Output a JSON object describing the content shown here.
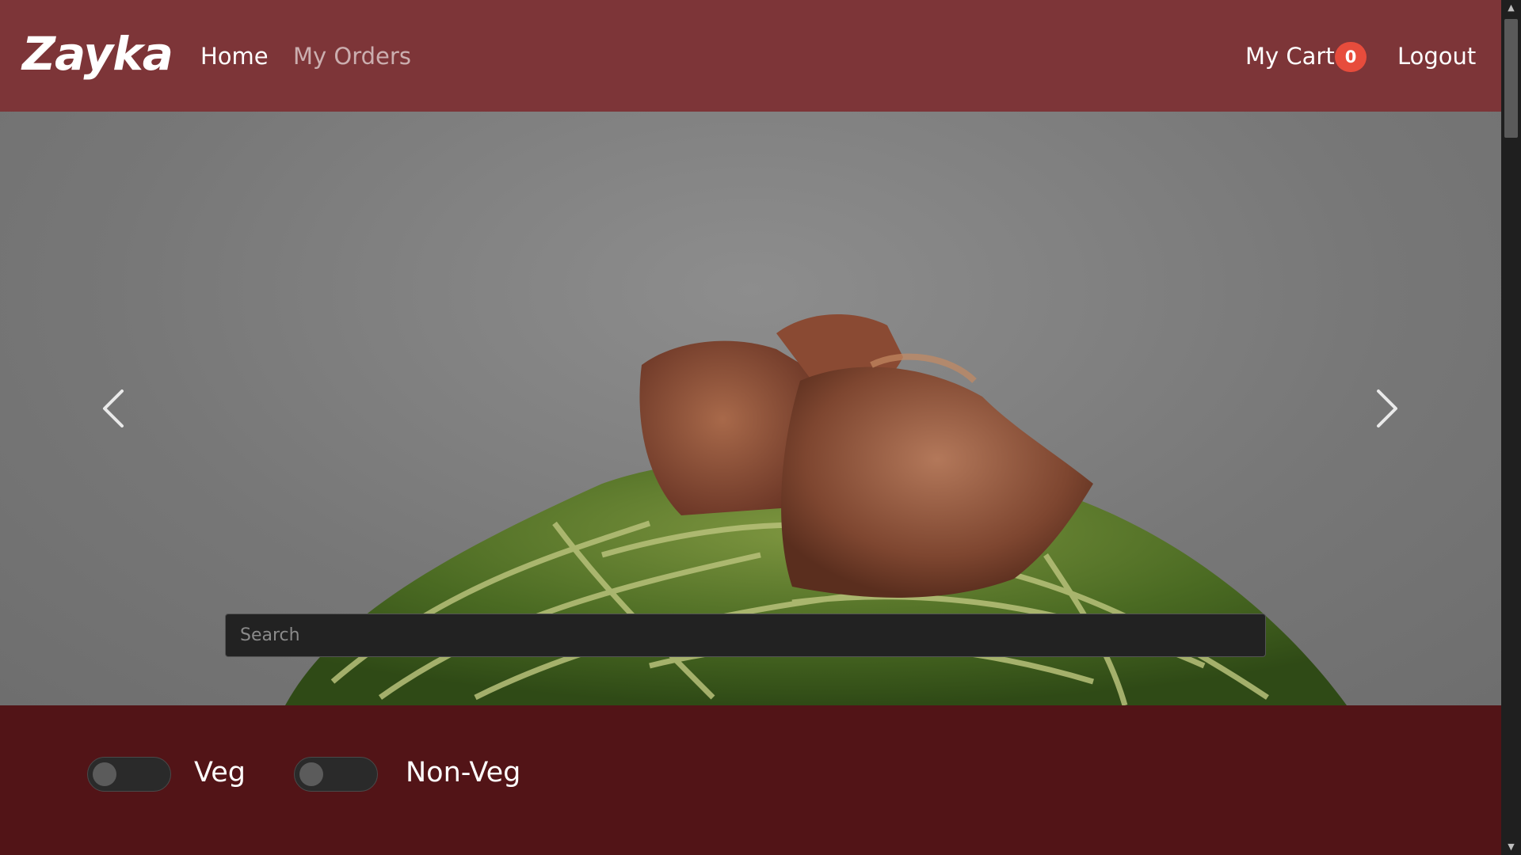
{
  "navbar": {
    "brand": "Zayka",
    "links": {
      "home": "Home",
      "orders": "My Orders",
      "cart": "My Cart",
      "logout": "Logout"
    },
    "cart_count": "0",
    "background": "#7d3538",
    "badge_color": "#e74c3c"
  },
  "hero": {
    "search_placeholder": "Search",
    "prev_icon": "chevron-left-icon",
    "next_icon": "chevron-right-icon"
  },
  "filters": {
    "veg_label": "Veg",
    "nonveg_label": "Non-Veg",
    "veg_enabled": false,
    "nonveg_enabled": false,
    "background": "#521417"
  }
}
